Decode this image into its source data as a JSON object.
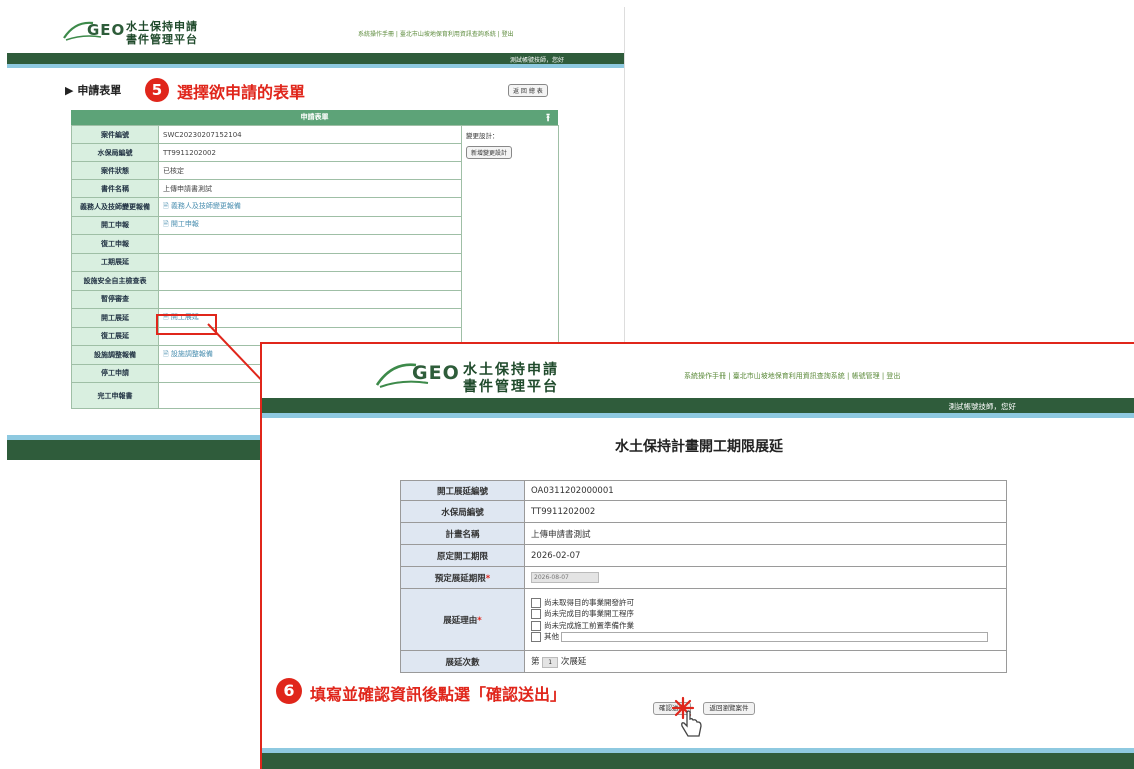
{
  "back_window": {
    "logo_text": "GEO",
    "logo_title_line1": "水土保持申請",
    "logo_title_line2": "書件管理平台",
    "top_links": "系統操作手冊 | 臺北市山坡地保育利用資訊查詢系統 | 登出",
    "user_greeting": "測試帳號技師，您好",
    "section_title": "申請表單",
    "step5_number": "5",
    "step5_text": "選擇欲申請的表單",
    "return_button": "返 回 總 表",
    "table_header": "申請表單",
    "rows": [
      {
        "label": "案件編號",
        "value": "SWC20230207152104"
      },
      {
        "label": "水保局編號",
        "value": "TT9911202002"
      },
      {
        "label": "案件狀態",
        "value": "已核定"
      },
      {
        "label": "書件名稱",
        "value": "上傳申請書測試"
      },
      {
        "label": "義務人及技師變更報備",
        "value": "義務人及技師變更報備"
      },
      {
        "label": "開工申報",
        "value": "開工申報"
      },
      {
        "label": "復工申報",
        "value": ""
      },
      {
        "label": "工期展延",
        "value": ""
      },
      {
        "label": "設施安全自主檢查表",
        "value": ""
      },
      {
        "label": "暫停審查",
        "value": ""
      },
      {
        "label": "開工展延",
        "value": "開工展延"
      },
      {
        "label": "復工展延",
        "value": ""
      },
      {
        "label": "設施調整報備",
        "value": "設施調整報備"
      },
      {
        "label": "停工申請",
        "value": ""
      },
      {
        "label": "完工申報書",
        "value": ""
      }
    ],
    "side_label": "變更設計：",
    "side_button": "新增變更設計"
  },
  "front_window": {
    "logo_text": "GEO",
    "logo_title_line1": "水土保持申請",
    "logo_title_line2": "書件管理平台",
    "top_links": "系統操作手冊 | 臺北市山坡地保育利用資訊查詢系統 |  帳號管理  |  登出",
    "user_greeting": "測試帳號技師，您好",
    "page_title": "水土保持計畫開工期限展延",
    "fields": {
      "ext_no_label": "開工展延編號",
      "ext_no_value": "OA0311202000001",
      "bureau_no_label": "水保局編號",
      "bureau_no_value": "TT9911202002",
      "plan_name_label": "計畫名稱",
      "plan_name_value": "上傳申請書測試",
      "orig_deadline_label": "原定開工期限",
      "orig_deadline_value": "2026-02-07",
      "expected_ext_label": "預定展延期限",
      "expected_ext_value": "2026-08-07",
      "reason_label": "展延理由",
      "reasons": [
        "尚未取得目的事業開發許可",
        "尚未完成目的事業開工程序",
        "尚未完成施工前置準備作業",
        "其他"
      ],
      "count_label": "展延次數",
      "count_prefix": "第",
      "count_value": "1",
      "count_suffix": "次展延"
    },
    "step6_number": "6",
    "step6_text": "填寫並確認資訊後點選「確認送出」",
    "confirm_button": "確認送出",
    "back_button": "返回瀏覽案件"
  },
  "colors": {
    "accent_red": "#e0261b",
    "dark_green": "#2f5c3b",
    "light_blue": "#8ec9e0"
  }
}
